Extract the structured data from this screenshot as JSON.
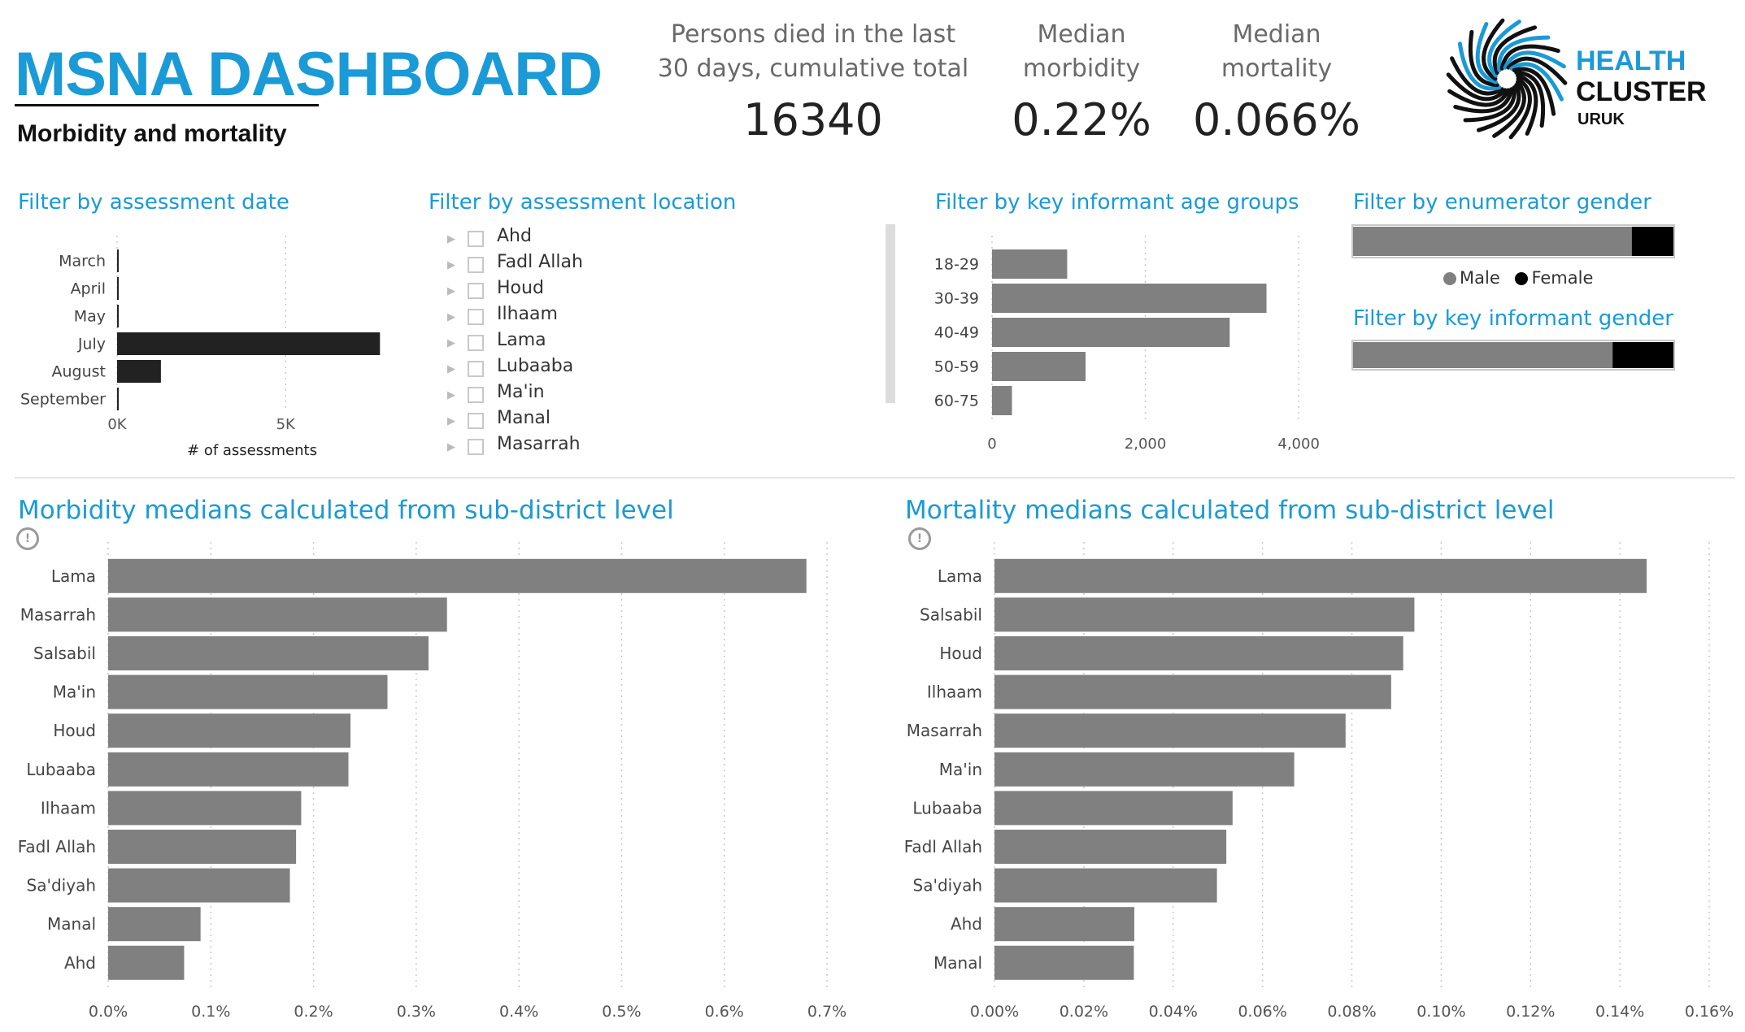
{
  "header": {
    "title": "MSNA DASHBOARD",
    "subtitle": "Morbidity and mortality"
  },
  "kpis": [
    {
      "label_line1": "Persons died in the last",
      "label_line2": "30 days, cumulative total",
      "value": "16340"
    },
    {
      "label_line1": "Median",
      "label_line2": "morbidity",
      "value": "0.22%"
    },
    {
      "label_line1": "Median",
      "label_line2": "mortality",
      "value": "0.066%"
    }
  ],
  "logo": {
    "line1": "HEALTH",
    "line2": "CLUSTER",
    "line3": "URUK",
    "icon": "spiral-logo-icon"
  },
  "filters": {
    "date_title": "Filter by assessment date",
    "location_title": "Filter by assessment location",
    "age_title": "Filter by key informant age groups",
    "enum_gender_title": "Filter by enumerator gender",
    "ki_gender_title": "Filter by key informant gender",
    "locations": [
      "Ahd",
      "Fadl Allah",
      "Houd",
      "Ilhaam",
      "Lama",
      "Lubaaba",
      "Ma'in",
      "Manal",
      "Masarrah"
    ],
    "legend_male": "Male",
    "legend_female": "Female"
  },
  "colors": {
    "accent": "#1a9ad6",
    "bar_gray": "#808080",
    "bar_dark": "#222222",
    "female": "#000000"
  },
  "sections": {
    "morbidity_title": "Morbidity medians calculated from sub-district level",
    "mortality_title": "Mortality medians calculated from sub-district level"
  },
  "chart_data": [
    {
      "id": "date",
      "type": "bar",
      "orientation": "horizontal",
      "categories": [
        "March",
        "April",
        "May",
        "July",
        "August",
        "September"
      ],
      "values": [
        20,
        20,
        20,
        7800,
        1300,
        20
      ],
      "xlabel": "# of assessments",
      "xlim": [
        0,
        9000
      ],
      "ticks": [
        0,
        5000
      ],
      "tick_labels": [
        "0K",
        "5K"
      ],
      "color": "#222222"
    },
    {
      "id": "age",
      "type": "bar",
      "orientation": "horizontal",
      "categories": [
        "18-29",
        "30-39",
        "40-49",
        "50-59",
        "60-75"
      ],
      "values": [
        980,
        3580,
        3100,
        1220,
        260
      ],
      "xlim": [
        0,
        4200
      ],
      "ticks": [
        0,
        2000,
        4000
      ],
      "tick_labels": [
        "0",
        "2,000",
        "4,000"
      ],
      "color": "#808080"
    },
    {
      "id": "enumerator_gender",
      "type": "bar",
      "orientation": "horizontal",
      "stacked": true,
      "categories": [
        "Male",
        "Female"
      ],
      "values": [
        87,
        13
      ],
      "colors": [
        "#808080",
        "#000000"
      ]
    },
    {
      "id": "ki_gender",
      "type": "bar",
      "orientation": "horizontal",
      "stacked": true,
      "categories": [
        "Male",
        "Female"
      ],
      "values": [
        81,
        19
      ],
      "colors": [
        "#808080",
        "#000000"
      ]
    },
    {
      "id": "morbidity",
      "type": "bar",
      "orientation": "horizontal",
      "categories": [
        "Lama",
        "Masarrah",
        "Salsabil",
        "Ma'in",
        "Houd",
        "Lubaaba",
        "Ilhaam",
        "Fadl Allah",
        "Sa'diyah",
        "Manal",
        "Ahd"
      ],
      "values": [
        0.68,
        0.33,
        0.312,
        0.272,
        0.236,
        0.234,
        0.188,
        0.183,
        0.177,
        0.09,
        0.074
      ],
      "xlim": [
        0,
        0.7
      ],
      "ticks": [
        0,
        0.1,
        0.2,
        0.3,
        0.4,
        0.5,
        0.6,
        0.7
      ],
      "tick_labels": [
        "0.0%",
        "0.1%",
        "0.2%",
        "0.3%",
        "0.4%",
        "0.5%",
        "0.6%",
        "0.7%"
      ],
      "grid": true,
      "color": "#808080"
    },
    {
      "id": "mortality",
      "type": "bar",
      "orientation": "horizontal",
      "categories": [
        "Lama",
        "Salsabil",
        "Houd",
        "Ilhaam",
        "Masarrah",
        "Ma'in",
        "Lubaaba",
        "Fadl Allah",
        "Sa'diyah",
        "Ahd",
        "Manal"
      ],
      "values": [
        0.146,
        0.094,
        0.0915,
        0.0888,
        0.0786,
        0.0671,
        0.0533,
        0.0519,
        0.0498,
        0.0313,
        0.0312
      ],
      "xlim": [
        0,
        0.16
      ],
      "ticks": [
        0,
        0.02,
        0.04,
        0.06,
        0.08,
        0.1,
        0.12,
        0.14,
        0.16
      ],
      "tick_labels": [
        "0.00%",
        "0.02%",
        "0.04%",
        "0.06%",
        "0.08%",
        "0.10%",
        "0.12%",
        "0.14%",
        "0.16%"
      ],
      "grid": true,
      "color": "#808080"
    }
  ]
}
